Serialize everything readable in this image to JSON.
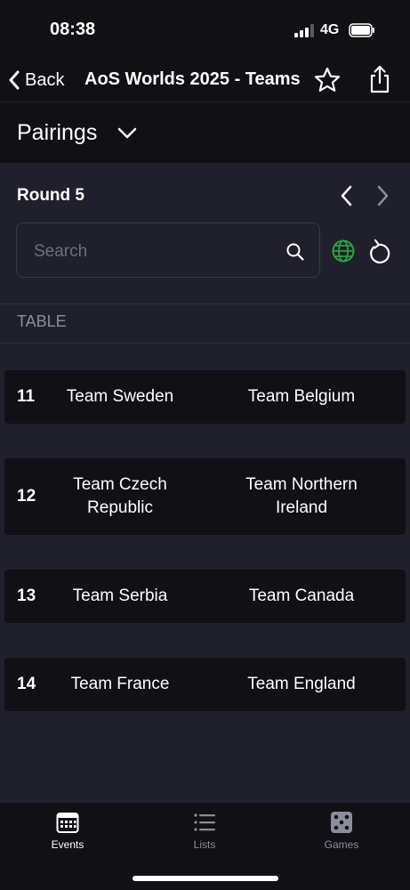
{
  "status_bar": {
    "time": "08:38",
    "network": "4G"
  },
  "nav": {
    "back_label": "Back",
    "title": "AoS Worlds 2025 - Teams"
  },
  "view_selector": {
    "label": "Pairings"
  },
  "round": {
    "title": "Round 5"
  },
  "search": {
    "placeholder": "Search",
    "value": ""
  },
  "table": {
    "header": "TABLE",
    "pairings": [
      {
        "table": "11",
        "team_a": "Team Sweden",
        "team_b": "Team Belgium"
      },
      {
        "table": "12",
        "team_a": "Team Czech Republic",
        "team_b": "Team Northern Ireland"
      },
      {
        "table": "13",
        "team_a": "Team Serbia",
        "team_b": "Team Canada"
      },
      {
        "table": "14",
        "team_a": "Team France",
        "team_b": "Team England"
      }
    ]
  },
  "tabs": [
    {
      "label": "Events",
      "icon": "calendar-icon",
      "active": true
    },
    {
      "label": "Lists",
      "icon": "list-icon",
      "active": false
    },
    {
      "label": "Games",
      "icon": "dice-icon",
      "active": false
    }
  ],
  "colors": {
    "background": "#1f202c",
    "header_background": "#101015",
    "row_background": "#101015",
    "muted_text": "#8b8d99",
    "globe_accent": "#2ea043"
  }
}
